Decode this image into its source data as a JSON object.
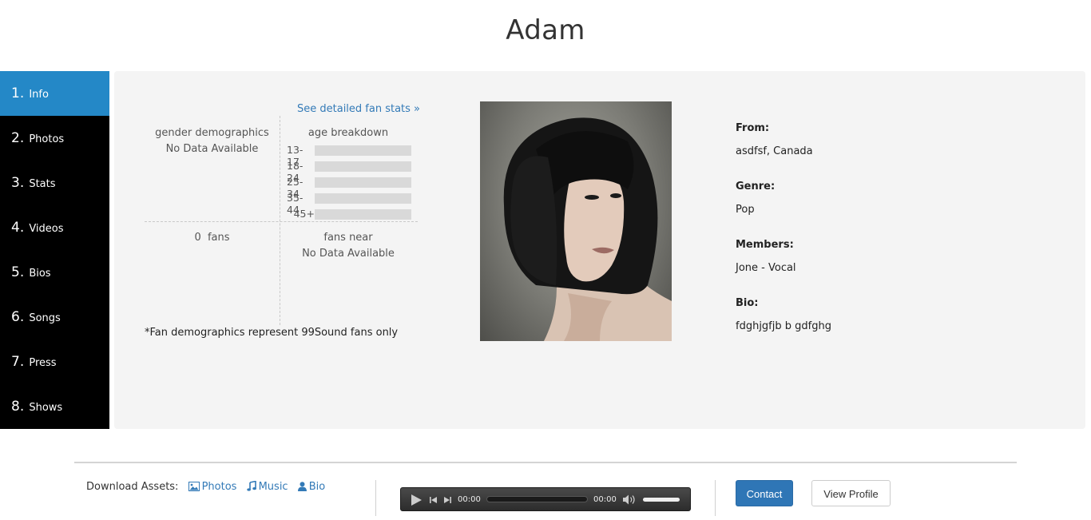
{
  "header": {
    "title": "Adam"
  },
  "sidebar": {
    "items": [
      {
        "num": "1.",
        "label": "Info",
        "active": true
      },
      {
        "num": "2.",
        "label": "Photos"
      },
      {
        "num": "3.",
        "label": "Stats"
      },
      {
        "num": "4.",
        "label": "Videos"
      },
      {
        "num": "5.",
        "label": "Bios"
      },
      {
        "num": "6.",
        "label": "Songs"
      },
      {
        "num": "7.",
        "label": "Press"
      },
      {
        "num": "8.",
        "label": "Shows"
      }
    ]
  },
  "stats": {
    "detailed_link": "See detailed fan stats »",
    "gender_title": "gender demographics",
    "gender_value": "No Data Available",
    "age_title": "age breakdown",
    "age_groups": [
      "13-17",
      "18-24",
      "25-34",
      "35-44",
      "45+"
    ],
    "fans_count": "0",
    "fans_label": "fans",
    "fans_near_title": "fans near",
    "fans_near_value": "No Data Available",
    "note": "*Fan demographics represent 99Sound fans only"
  },
  "profile": {
    "from_label": "From:",
    "from_value": "asdfsf, Canada",
    "genre_label": "Genre:",
    "genre_value": "Pop",
    "members_label": "Members:",
    "members_value": "Jone - Vocal",
    "bio_label": "Bio:",
    "bio_value": "fdghjgfjb b gdfghg"
  },
  "footer": {
    "assets_label": "Download Assets:",
    "assets": [
      {
        "label": "Photos",
        "icon": "image-icon"
      },
      {
        "label": "Music",
        "icon": "music-note-icon"
      },
      {
        "label": "Bio",
        "icon": "user-icon"
      }
    ],
    "player": {
      "current_time": "00:00",
      "duration": "00:00"
    },
    "contact_label": "Contact",
    "view_profile_label": "View Profile"
  },
  "colors": {
    "accent": "#2488c7",
    "link": "#337ab7",
    "sidebar_bg": "#000000",
    "panel_bg": "#f4f4f4",
    "button_primary": "#2f76b6"
  }
}
